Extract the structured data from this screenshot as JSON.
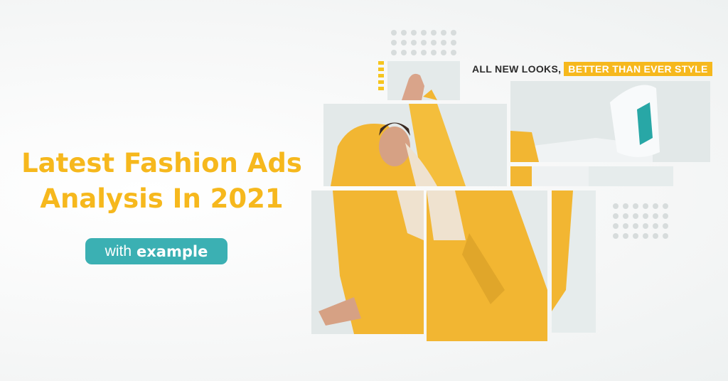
{
  "headline": {
    "line1": "Latest Fashion Ads",
    "line2": "Analysis In 2021"
  },
  "badge": {
    "prefix": "with",
    "emphasis": "example"
  },
  "tagline": {
    "lead": "ALL NEW LOOKS,",
    "highlight": "BETTER THAN EVER STYLE"
  },
  "colors": {
    "accent_yellow": "#f6b81d",
    "badge_teal": "#3bb0b3",
    "tagline_dark": "#2b2b2b",
    "dot_gray": "#d7dcdc"
  },
  "imagery": {
    "subject": "model-in-yellow-raincoat-photo",
    "icon": "photo-collage-icon"
  }
}
